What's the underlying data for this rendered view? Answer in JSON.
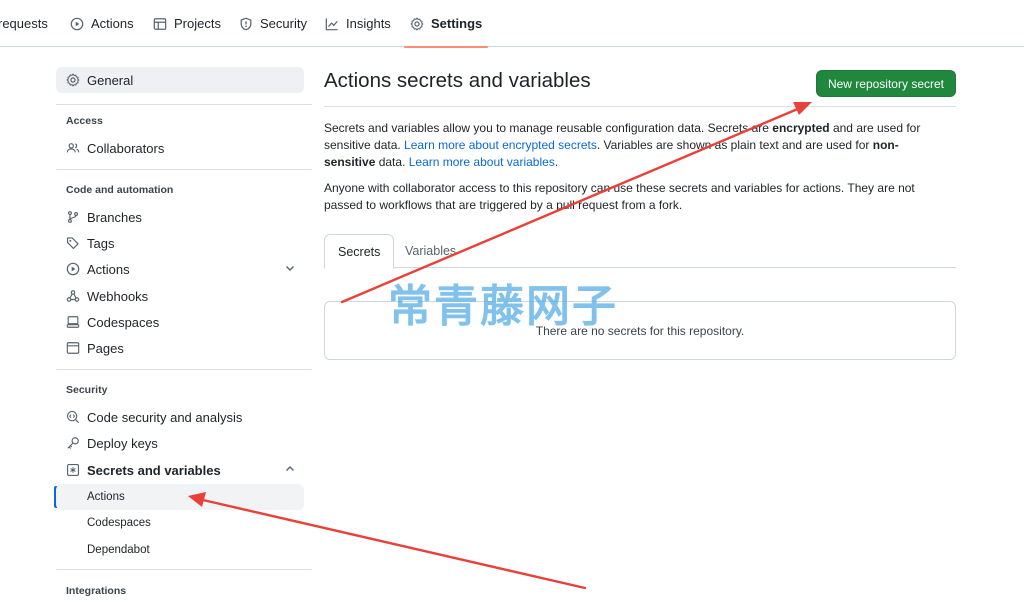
{
  "colors": {
    "accent_link": "#0969da",
    "primary_button": "#1f883d",
    "selected_tab_underline": "#fd8c73",
    "annotation_arrow": "#e8413a",
    "watermark": "#50aae6"
  },
  "topnav": {
    "tabs": [
      {
        "label": "requests",
        "icon": ""
      },
      {
        "label": "Actions",
        "icon": "play-icon"
      },
      {
        "label": "Projects",
        "icon": "table-icon"
      },
      {
        "label": "Security",
        "icon": "shield-icon"
      },
      {
        "label": "Insights",
        "icon": "graph-icon"
      },
      {
        "label": "Settings",
        "icon": "gear-icon",
        "selected": true
      }
    ]
  },
  "sidebar": {
    "general": "General",
    "access_heading": "Access",
    "collaborators": "Collaborators",
    "code_heading": "Code and automation",
    "branches": "Branches",
    "tags": "Tags",
    "actions": "Actions",
    "webhooks": "Webhooks",
    "codespaces": "Codespaces",
    "pages": "Pages",
    "security_heading": "Security",
    "code_security": "Code security and analysis",
    "deploy_keys": "Deploy keys",
    "secrets_variables": "Secrets and variables",
    "sub_actions": "Actions",
    "sub_codespaces": "Codespaces",
    "sub_dependabot": "Dependabot",
    "integrations_heading": "Integrations"
  },
  "main": {
    "title": "Actions secrets and variables",
    "new_secret_button": "New repository secret",
    "intro": {
      "t1": "Secrets and variables allow you to manage reusable configuration data. Secrets are ",
      "t1_bold": "encrypted",
      "t2": " and are used for sensitive data. ",
      "link1": "Learn more about encrypted secrets",
      "t3": ". Variables are shown as plain text and are used for ",
      "t3_bold": "non-sensitive",
      "t4": " data. ",
      "link2": "Learn more about variables",
      "t5": "."
    },
    "access_note": "Anyone with collaborator access to this repository can use these secrets and variables for actions. They are not passed to workflows that are triggered by a pull request from a fork.",
    "tabs": [
      "Secrets",
      "Variables"
    ],
    "empty_message": "There are no secrets for this repository."
  },
  "watermark": "常青藤网子"
}
